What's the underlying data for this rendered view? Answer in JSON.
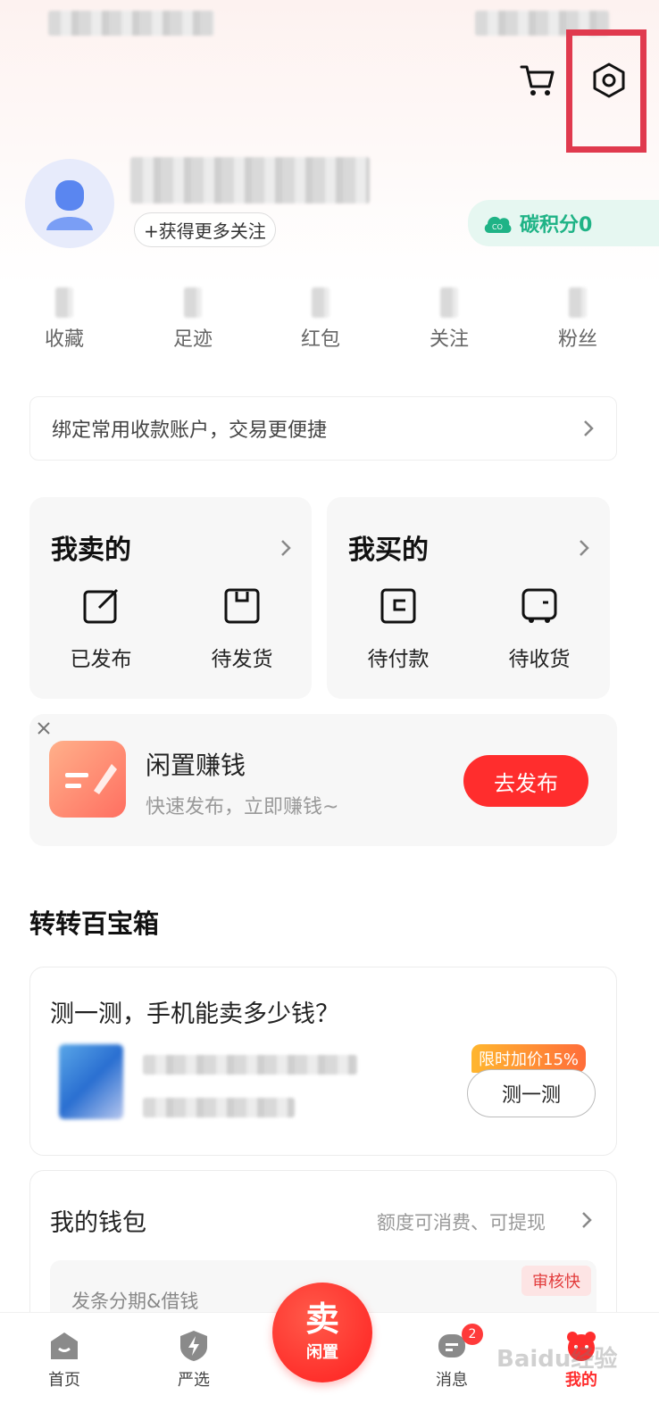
{
  "topbar": {
    "cart_icon": "cart-icon",
    "settings_icon": "settings-icon"
  },
  "profile": {
    "follow_chip": "+获得更多关注",
    "carbon_label": "碳积分0"
  },
  "stats": [
    {
      "label": "收藏"
    },
    {
      "label": "足迹"
    },
    {
      "label": "红包"
    },
    {
      "label": "关注"
    },
    {
      "label": "粉丝"
    }
  ],
  "bind_bar": {
    "text": "绑定常用收款账户，交易更便捷"
  },
  "sell_card": {
    "title": "我卖的",
    "items": [
      {
        "label": "已发布"
      },
      {
        "label": "待发货"
      }
    ]
  },
  "buy_card": {
    "title": "我买的",
    "items": [
      {
        "label": "待付款"
      },
      {
        "label": "待收货"
      }
    ]
  },
  "promo": {
    "title": "闲置赚钱",
    "subtitle": "快速发布，立即赚钱~",
    "button": "去发布"
  },
  "toolbox": {
    "section_title": "转转百宝箱",
    "card_title": "测一测，手机能卖多少钱？",
    "tag": "限时加价15%",
    "button": "测一测"
  },
  "wallet": {
    "title": "我的钱包",
    "subtitle": "额度可消费、可提现",
    "row_text": "发条分期&借钱",
    "tag": "审核快"
  },
  "bottom_nav": {
    "home": "首页",
    "select": "严选",
    "sell_top": "卖",
    "sell_bottom": "闲置",
    "messages": "消息",
    "messages_badge": "2",
    "mine": "我的"
  },
  "watermark": "Baidu经验",
  "colors": {
    "accent_red": "#ff2d2d",
    "carbon_green": "#1fb386",
    "highlight": "#e03a4e"
  }
}
